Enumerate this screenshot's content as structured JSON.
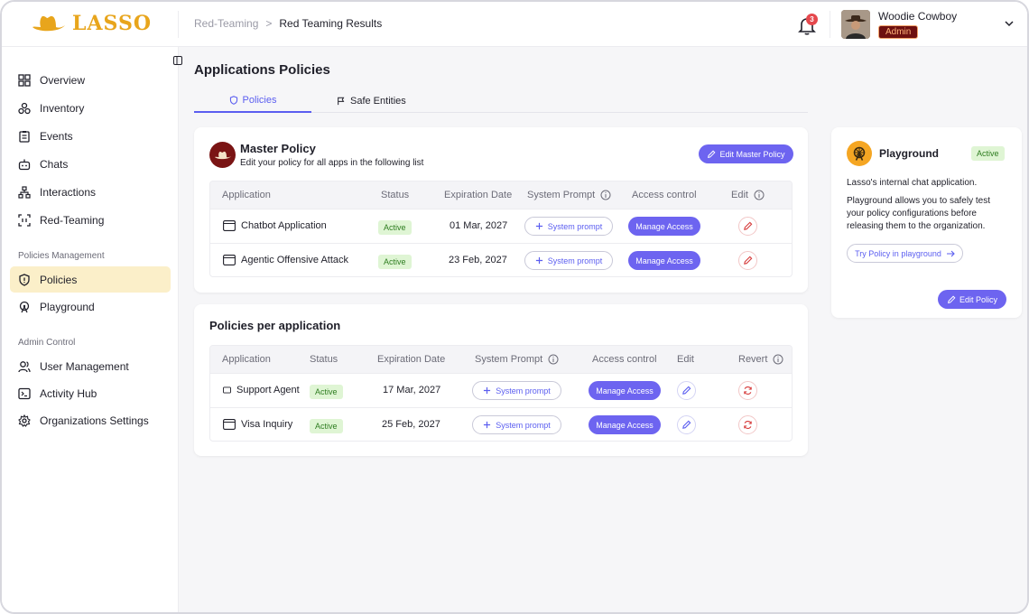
{
  "brand": {
    "name": "LASSO"
  },
  "breadcrumb": {
    "parent": "Red-Teaming",
    "separator": ">",
    "current": "Red Teaming Results"
  },
  "notifications": {
    "count": "3"
  },
  "user": {
    "name": "Woodie Cowboy",
    "role": "Admin"
  },
  "sidebar": {
    "items": [
      {
        "label": "Overview",
        "icon": "grid-icon"
      },
      {
        "label": "Inventory",
        "icon": "boxes-icon"
      },
      {
        "label": "Events",
        "icon": "clipboard-icon"
      },
      {
        "label": "Chats",
        "icon": "bot-icon"
      },
      {
        "label": "Interactions",
        "icon": "network-icon"
      },
      {
        "label": "Red-Teaming",
        "icon": "scan-icon"
      }
    ],
    "section_policies": "Policies Management",
    "policies_items": [
      {
        "label": "Policies",
        "icon": "shield-icon",
        "active": true
      },
      {
        "label": "Playground",
        "icon": "ferris-wheel-icon"
      }
    ],
    "section_admin": "Admin Control",
    "admin_items": [
      {
        "label": "User Management",
        "icon": "users-icon"
      },
      {
        "label": "Activity Hub",
        "icon": "terminal-icon"
      },
      {
        "label": "Organizations Settings",
        "icon": "gear-icon"
      }
    ]
  },
  "page": {
    "title": "Applications Policies",
    "tabs": [
      {
        "label": "Policies"
      },
      {
        "label": "Safe Entities"
      }
    ]
  },
  "master_policy": {
    "title": "Master Policy",
    "subtitle": "Edit your policy for all apps in the following list",
    "edit_button": "Edit Master Policy",
    "columns": [
      "Application",
      "Status",
      "Expiration Date",
      "System Prompt",
      "Access control",
      "Edit"
    ],
    "rows": [
      {
        "application": "Chatbot Application",
        "status": "Active",
        "expiration": "01 Mar, 2027",
        "system_prompt": "System prompt",
        "access": "Manage Access"
      },
      {
        "application": "Agentic Offensive Attack",
        "status": "Active",
        "expiration": "23 Feb, 2027",
        "system_prompt": "System prompt",
        "access": "Manage Access"
      }
    ]
  },
  "per_application": {
    "title": "Policies per application",
    "columns": [
      "Application",
      "Status",
      "Expiration Date",
      "System Prompt",
      "Access control",
      "Edit",
      "Revert"
    ],
    "rows": [
      {
        "application": "Support Agent",
        "status": "Active",
        "expiration": "17 Mar, 2027",
        "system_prompt": "System prompt",
        "access": "Manage Access"
      },
      {
        "application": "Visa Inquiry",
        "status": "Active",
        "expiration": "25 Feb, 2027",
        "system_prompt": "System prompt",
        "access": "Manage Access"
      }
    ]
  },
  "playground": {
    "title": "Playground",
    "status": "Active",
    "description_1": "Lasso's internal chat application.",
    "description_2": "Playground allows you to safely test your policy configurations before releasing them to the organization.",
    "try_button": "Try Policy in playground",
    "edit_button": "Edit Policy"
  },
  "colors": {
    "accent": "#6d64f0",
    "brand": "#e8a51c",
    "active_bg": "#dff5d4",
    "nav_active": "#fbefc9"
  }
}
